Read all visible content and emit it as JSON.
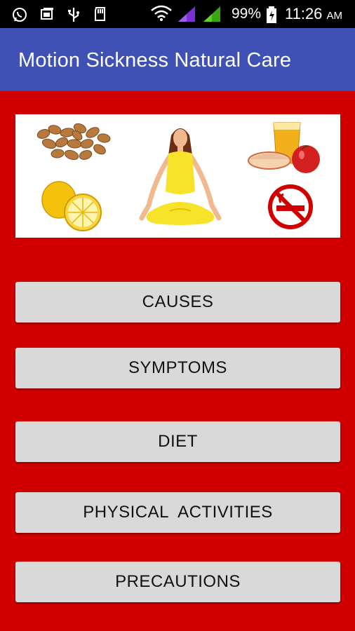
{
  "status_bar": {
    "battery": "99%",
    "time": "11:26",
    "ampm": "AM",
    "icons": [
      "whatsapp-icon",
      "gallery-icon",
      "usb-icon",
      "sd-card-icon",
      "wifi-icon",
      "signal-icon",
      "signal-icon",
      "battery-icon"
    ]
  },
  "app_bar": {
    "title": "Motion Sickness Natural Care"
  },
  "banner": {
    "images": [
      "almonds",
      "yoga-woman",
      "apple-juice",
      "lemon",
      "no-smoking"
    ]
  },
  "menu": {
    "causes": "CAUSES",
    "symptoms": "SYMPTOMS",
    "diet": "DIET",
    "physical_activities": "PHYSICAL  ACTIVITIES",
    "precautions": "PRECAUTIONS"
  },
  "colors": {
    "background": "#d10000",
    "app_bar": "#3f51b5",
    "button": "#d9d9d9"
  }
}
